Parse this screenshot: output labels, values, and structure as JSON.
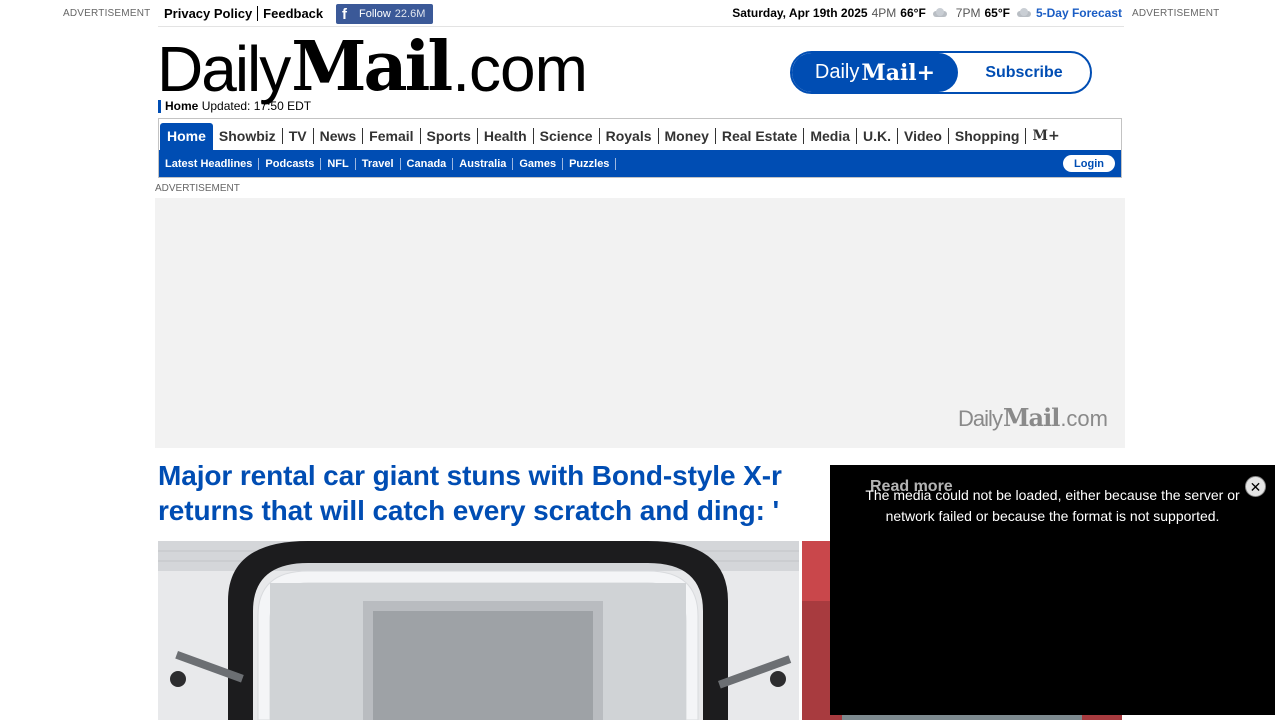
{
  "ads": {
    "label": "ADVERTISEMENT"
  },
  "topbar": {
    "privacy": "Privacy Policy",
    "feedback": "Feedback",
    "facebook": {
      "icon": "f",
      "label": "Follow",
      "count": "22.6M"
    },
    "weather": {
      "date": "Saturday, Apr 19th 2025",
      "time1": "4PM",
      "temp1": "66°F",
      "time2": "7PM",
      "temp2": "65°F",
      "forecast": "5-Day Forecast"
    }
  },
  "masthead": {
    "logo_part1": "Daily",
    "logo_part2": "Mail",
    "logo_part3": ".com",
    "subscribe_brand_1": "Daily",
    "subscribe_brand_2": "Mail+",
    "subscribe_label": "Subscribe",
    "home": "Home",
    "updated": "Updated: 17:50 EDT"
  },
  "nav": {
    "main": [
      "Home",
      "Showbiz",
      "TV",
      "News",
      "Femail",
      "Sports",
      "Health",
      "Science",
      "Royals",
      "Money",
      "Real Estate",
      "Media",
      "U.K.",
      "Video",
      "Shopping",
      "M+"
    ],
    "sub": [
      "Latest Headlines",
      "Podcasts",
      "NFL",
      "Travel",
      "Canada",
      "Australia",
      "Games",
      "Puzzles"
    ],
    "login": "Login",
    "accent": "#004db3"
  },
  "ad_block": {
    "logo_1": "Daily",
    "logo_2": "Mail",
    "logo_3": ".com"
  },
  "article": {
    "headline": "Major rental car giant stuns with Bond-style X-r ... returns that will catch every scratch and ding: '",
    "headline_line1": "Major rental car giant stuns with Bond-style X-r",
    "headline_line2": "returns that will catch every scratch and ding: '"
  },
  "video": {
    "read_more": "Read more",
    "error": "The media could not be loaded, either because the server or network failed or because the format is not supported.",
    "close": "✕"
  }
}
